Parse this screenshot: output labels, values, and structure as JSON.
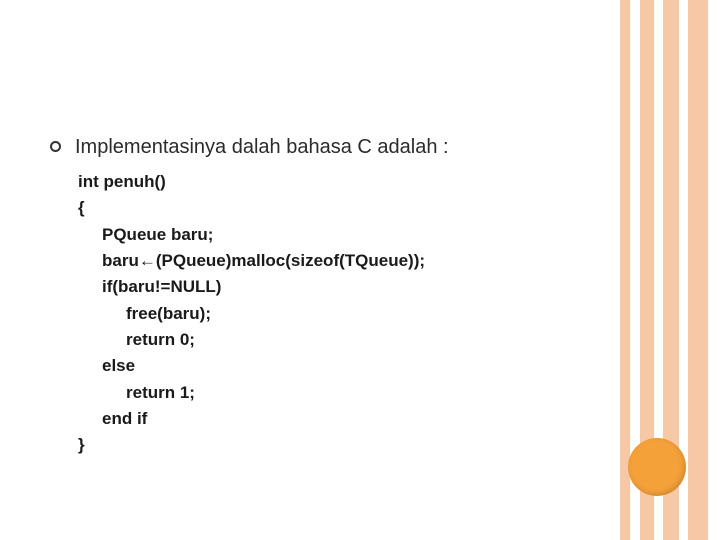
{
  "slide": {
    "intro": "Implementasinya dalah bahasa C adalah :",
    "code": {
      "line0": "int penuh()",
      "line1": "{",
      "line2": "PQueue baru;",
      "line3a": "baru",
      "line3arrow": "←",
      "line3b": "(PQueue)malloc(sizeof(TQueue));",
      "line4": "if(baru!=NULL)",
      "line5": "free(baru);",
      "line6": "return 0;",
      "line7": "else",
      "line8": "return 1;",
      "line9": "end if",
      "line10": "}"
    }
  }
}
